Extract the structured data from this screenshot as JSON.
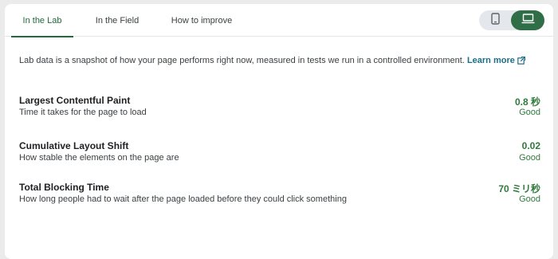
{
  "tabs": [
    {
      "label": "In the Lab",
      "active": true
    },
    {
      "label": "In the Field",
      "active": false
    },
    {
      "label": "How to improve",
      "active": false
    }
  ],
  "device_toggle": {
    "options": [
      {
        "icon": "smartphone-icon",
        "selected": false
      },
      {
        "icon": "desktop-icon",
        "selected": true
      }
    ]
  },
  "intro": {
    "text": "Lab data is a snapshot of how your page performs right now, measured in tests we run in a controlled environment.",
    "link_label": "Learn more",
    "link_icon": "external-link-icon"
  },
  "metrics": [
    {
      "name": "Largest Contentful Paint",
      "description": "Time it takes for the page to load",
      "value": "0.8 秒",
      "rating": "Good"
    },
    {
      "name": "Cumulative Layout Shift",
      "description": "How stable the elements on the page are",
      "value": "0.02",
      "rating": "Good"
    },
    {
      "name": "Total Blocking Time",
      "description": "How long people had to wait after the page loaded before they could click something",
      "value": "70 ミリ秒",
      "rating": "Good"
    }
  ],
  "colors": {
    "accent": "#1e6b3c",
    "good": "#2f7a3c",
    "link": "#1a6e8a",
    "toggle_selected": "#2f6e47"
  }
}
